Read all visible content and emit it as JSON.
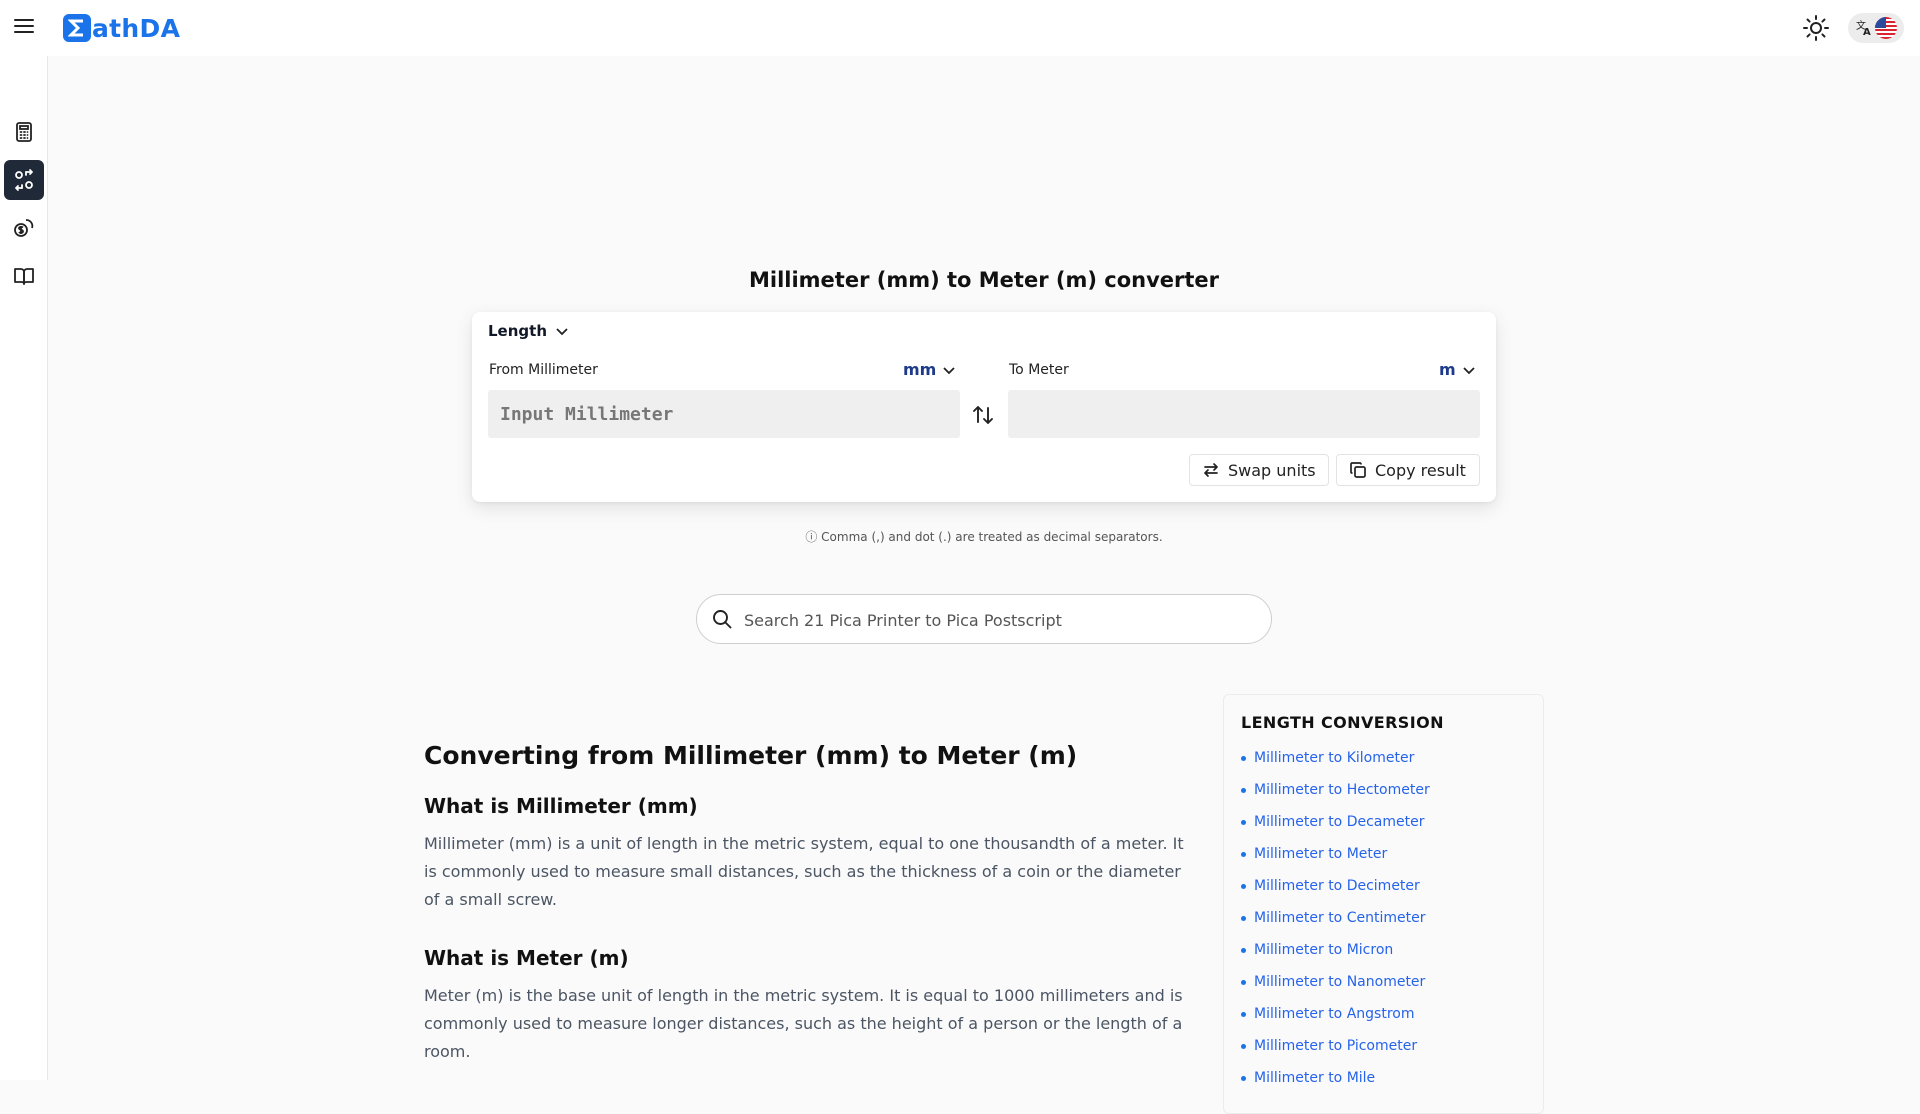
{
  "app": {
    "name": "athDA",
    "logo_glyph": "Σ",
    "accent_color": "#1a73e8"
  },
  "header": {
    "menu_icon": "hamburger-menu-icon",
    "theme_icon": "sun-icon",
    "language_icon": "translate-icon",
    "language_flag": "us-flag-icon"
  },
  "sidebar": {
    "items": [
      {
        "icon": "calculator-icon",
        "active": false
      },
      {
        "icon": "converter-icon",
        "active": true
      },
      {
        "icon": "currency-icon",
        "active": false
      },
      {
        "icon": "book-icon",
        "active": false
      }
    ]
  },
  "converter": {
    "title": "Millimeter (mm) to Meter (m) converter",
    "category": "Length",
    "from_label": "From Millimeter",
    "from_unit": "mm",
    "from_placeholder": "Input Millimeter",
    "from_value": "",
    "to_label": "To Meter",
    "to_unit": "m",
    "to_value": "",
    "swap_label": "Swap units",
    "copy_label": "Copy result",
    "note": "ⓘ Comma (,) and dot (.) are treated as decimal separators."
  },
  "search": {
    "placeholder": "Search 21 Pica Printer to Pica Postscript"
  },
  "article": {
    "heading": "Converting from Millimeter (mm) to Meter (m)",
    "sections": [
      {
        "title": "What is Millimeter (mm)",
        "body": "Millimeter (mm) is a unit of length in the metric system, equal to one thousandth of a meter. It is commonly used to measure small distances, such as the thickness of a coin or the diameter of a small screw."
      },
      {
        "title": "What is Meter (m)",
        "body": "Meter (m) is the base unit of length in the metric system. It is equal to 1000 millimeters and is commonly used to measure longer distances, such as the height of a person or the length of a room."
      }
    ]
  },
  "related": {
    "title": "LENGTH CONVERSION",
    "links": [
      "Millimeter to Kilometer",
      "Millimeter to Hectometer",
      "Millimeter to Decameter",
      "Millimeter to Meter",
      "Millimeter to Decimeter",
      "Millimeter to Centimeter",
      "Millimeter to Micron",
      "Millimeter to Nanometer",
      "Millimeter to Angstrom",
      "Millimeter to Picometer",
      "Millimeter to Mile"
    ]
  }
}
